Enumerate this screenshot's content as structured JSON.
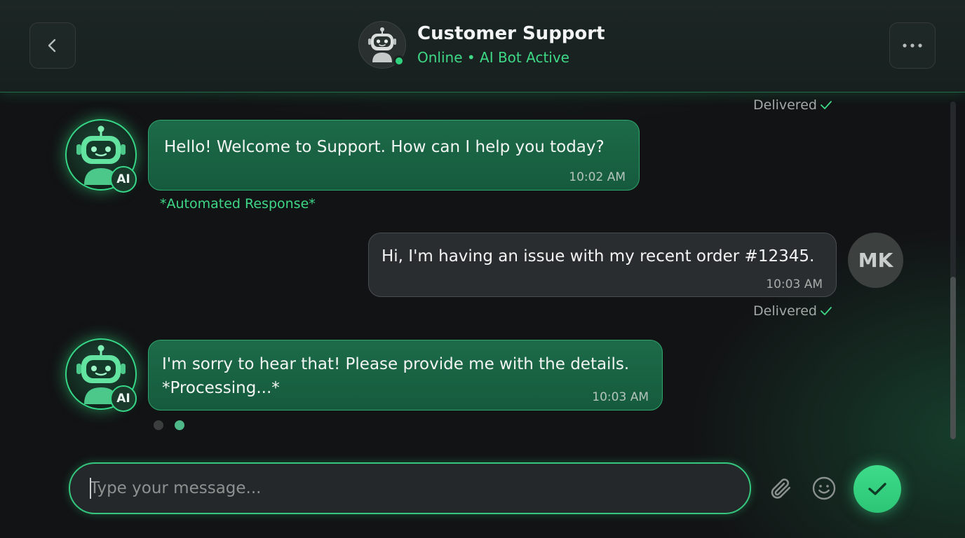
{
  "header": {
    "title": "Customer Support",
    "status": "Online • AI Bot Active",
    "back_icon": "chevron-left-icon",
    "more_icon": "more-horizontal-icon",
    "avatar_icon": "robot-icon"
  },
  "messages": [
    {
      "sender": "bot",
      "text_lines": [
        "Hello! Welcome to Support. How can I help you today?"
      ],
      "time": "10:02 AM",
      "badge": "AI",
      "note": "*Automated Response*"
    },
    {
      "sender": "user",
      "avatar_initials": "MK",
      "text_lines": [
        "Hi, I'm having an issue with my recent order #12345."
      ],
      "time": "10:03 AM"
    },
    {
      "sender": "bot",
      "text_lines": [
        "I'm sorry to hear that! Please provide me with the details.",
        "*Processing...*"
      ],
      "time": "10:03 AM",
      "badge": "AI"
    }
  ],
  "receipts": [
    "Delivered",
    "Delivered"
  ],
  "composer": {
    "placeholder": "Type your message...",
    "value": "",
    "attach_icon": "paperclip-icon",
    "emoji_icon": "smiley-icon",
    "send_icon": "check-icon"
  },
  "colors": {
    "accent": "#36d787",
    "bot_bubble": "#1c6b49",
    "user_bubble": "#2a2d2f",
    "background": "#121315"
  }
}
